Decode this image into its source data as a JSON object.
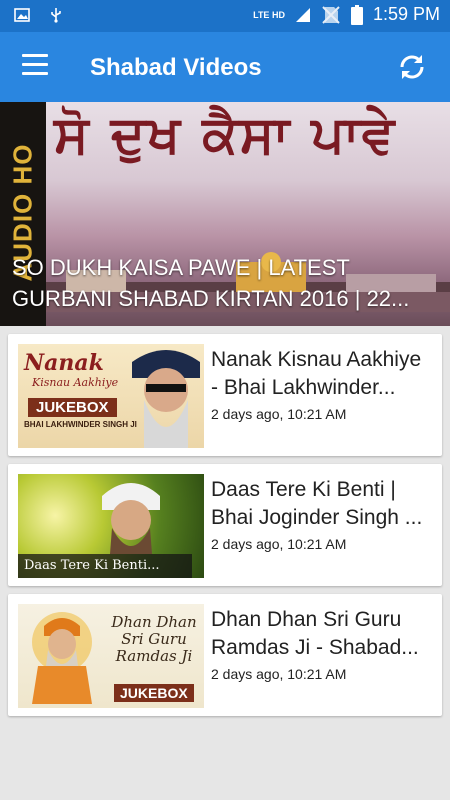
{
  "status_bar": {
    "network": "LTE HD",
    "time": "1:59 PM"
  },
  "app_bar": {
    "title": "Shabad Videos",
    "menu_icon": "hamburger-menu-icon",
    "refresh_icon": "refresh-icon"
  },
  "featured": {
    "side_text": "AUDIO HO",
    "title_art": "ਸੋ ਦੁਖ ਕੈਸਾ ਪਾਵੇ",
    "title_line1": "SO DUKH KAISA PAWE | LATEST",
    "title_line2": "GURBANI SHABAD KIRTAN 2016 | 22..."
  },
  "videos": [
    {
      "title_line1": "Nanak Kisnau Aakhiye",
      "title_line2": "- Bhai Lakhwinder...",
      "time": "2 days ago, 10:21 AM",
      "thumb_title": "Nanak",
      "thumb_subtitle": "Kisnau Aakhiye",
      "thumb_badge": "JUKEBOX",
      "thumb_singer": "BHAI LAKHWINDER SINGH JI"
    },
    {
      "title_line1": "Daas Tere Ki Benti |",
      "title_line2": "Bhai Joginder Singh ...",
      "time": "2 days ago, 10:21 AM",
      "thumb_caption": "Daas Tere Ki Benti..."
    },
    {
      "title_line1": "Dhan Dhan Sri Guru",
      "title_line2": "Ramdas Ji - Shabad...",
      "time": "2 days ago, 10:21 AM",
      "thumb_title": "Dhan Dhan Sri Guru Ramdas Ji",
      "thumb_badge": "JUKEBOX"
    }
  ],
  "colors": {
    "status_bar": "#1c72c8",
    "app_bar": "#2a86e0",
    "background": "#e6e6e6"
  }
}
